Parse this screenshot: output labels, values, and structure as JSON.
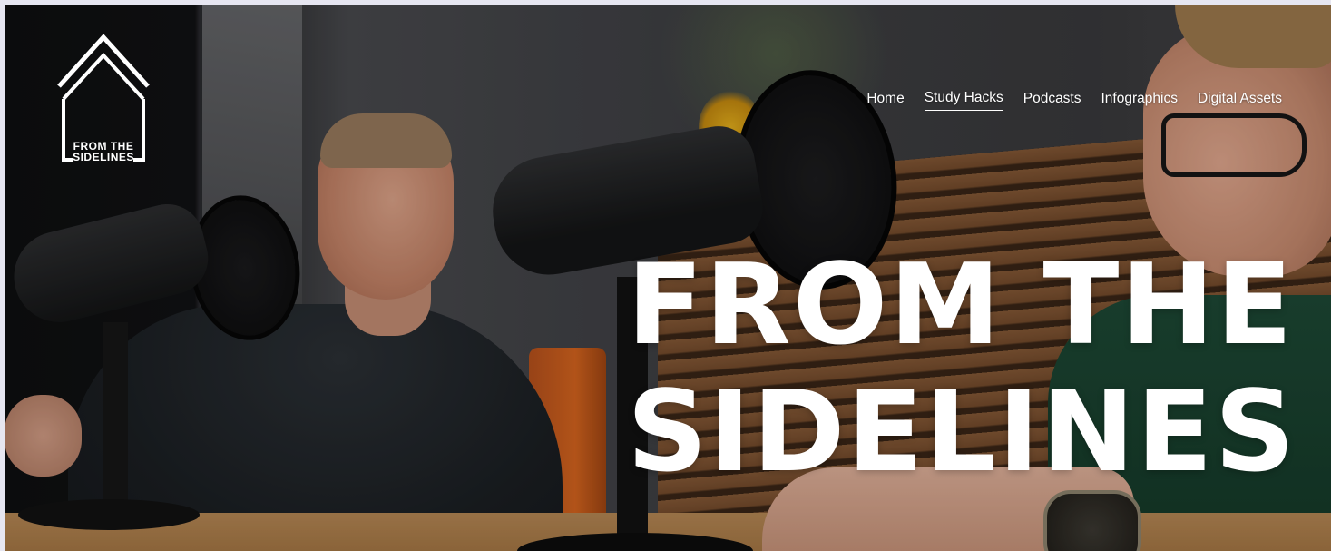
{
  "brand": {
    "logo_line1": "FROM THE",
    "logo_line2": "SIDELINES"
  },
  "nav": {
    "items": [
      {
        "label": "Home",
        "active": false
      },
      {
        "label": "Study Hacks",
        "active": true
      },
      {
        "label": "Podcasts",
        "active": false
      },
      {
        "label": "Infographics",
        "active": false
      },
      {
        "label": "Digital Assets",
        "active": false
      }
    ]
  },
  "hero": {
    "line1": "FROM THE",
    "line2": "SIDELINES"
  },
  "colors": {
    "text": "#ffffff",
    "page_border": "#e6e6f1"
  }
}
